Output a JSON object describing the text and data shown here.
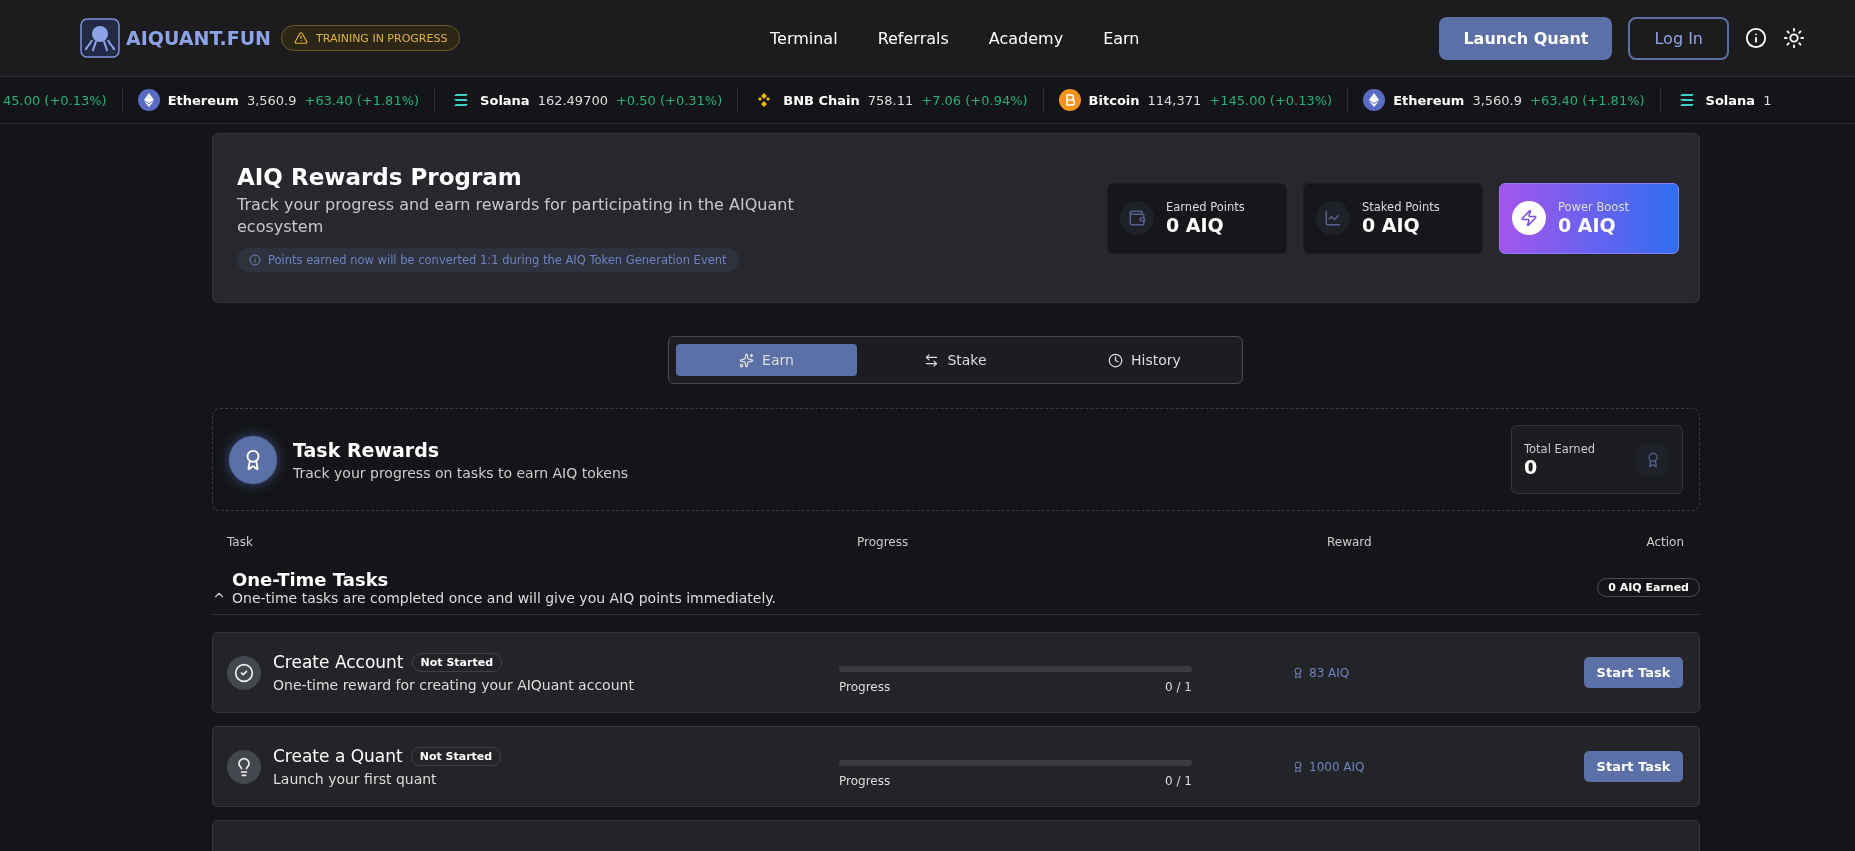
{
  "header": {
    "logo": "AIQUANT.FUN",
    "badge": "TRAINING IN PROGRESS",
    "nav": [
      {
        "label": "Terminal"
      },
      {
        "label": "Referrals"
      },
      {
        "label": "Academy"
      },
      {
        "label": "Earn"
      }
    ],
    "launch_button": "Launch Quant",
    "login_button": "Log In"
  },
  "ticker": [
    {
      "kind": "partial",
      "change": "45.00 (+0.13%)"
    },
    {
      "kind": "eth",
      "name": "Ethereum",
      "price": "3,560.9",
      "change": "+63.40 (+1.81%)"
    },
    {
      "kind": "sol",
      "name": "Solana",
      "price": "162.49700",
      "change": "+0.50 (+0.31%)"
    },
    {
      "kind": "bnb",
      "name": "BNB Chain",
      "price": "758.11",
      "change": "+7.06 (+0.94%)"
    },
    {
      "kind": "btc",
      "name": "Bitcoin",
      "price": "114,371",
      "change": "+145.00 (+0.13%)"
    },
    {
      "kind": "eth",
      "name": "Ethereum",
      "price": "3,560.9",
      "change": "+63.40 (+1.81%)"
    },
    {
      "kind": "sol",
      "name": "Solana",
      "price": "1"
    }
  ],
  "rewards": {
    "title": "AIQ Rewards Program",
    "description": "Track your progress and earn rewards for participating in the AIQuant ecosystem",
    "note": "Points earned now will be converted 1:1 during the AIQ Token Generation Event",
    "stats": [
      {
        "kind": "earned",
        "label": "Earned Points",
        "value": "0 AIQ"
      },
      {
        "kind": "staked",
        "label": "Staked Points",
        "value": "0 AIQ"
      },
      {
        "kind": "boost",
        "label": "Power Boost",
        "value": "0 AIQ"
      }
    ]
  },
  "tabs": [
    {
      "kind": "earn",
      "label": "Earn",
      "selected": true
    },
    {
      "kind": "stake",
      "label": "Stake",
      "selected": false
    },
    {
      "kind": "history",
      "label": "History",
      "selected": false
    }
  ],
  "task_rewards": {
    "title": "Task Rewards",
    "subtitle": "Track your progress on tasks to earn AIQ tokens",
    "total_label": "Total Earned",
    "total_value": "0"
  },
  "table": {
    "columns": [
      "Task",
      "Progress",
      "Reward",
      "Action"
    ],
    "groups": [
      {
        "title": "One-Time Tasks",
        "description": "One-time tasks are completed once and will give you AIQ points immediately.",
        "expanded": true,
        "earned": "0 AIQ Earned",
        "tasks": [
          {
            "kind": "check",
            "title": "Create Account",
            "status": "Not Started",
            "description": "One-time reward for creating your AIQuant account",
            "progress_label": "Progress",
            "count": "0 / 1",
            "level": 0,
            "reward": "83 AIQ",
            "action": "Start Task"
          },
          {
            "kind": "bulb",
            "title": "Create a Quant",
            "status": "Not Started",
            "description": "Launch your first quant",
            "progress_label": "Progress",
            "count": "0 / 1",
            "level": 0,
            "reward": "1000 AIQ",
            "action": "Start Task"
          }
        ]
      }
    ]
  }
}
